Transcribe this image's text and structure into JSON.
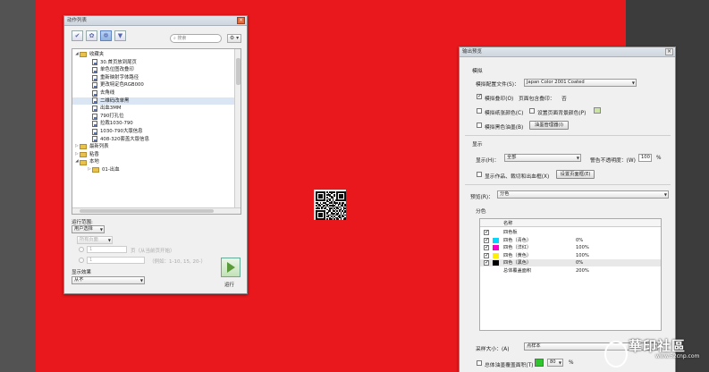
{
  "actions_panel": {
    "title": "动作列表",
    "close": "×",
    "search_placeholder": "搜索",
    "gear": "⚙ ▾",
    "tree": [
      {
        "label": "收藏夹",
        "type": "folder",
        "level": 0,
        "expanded": true
      },
      {
        "label": "30.首页放到尾页",
        "type": "doc",
        "level": 1
      },
      {
        "label": "单色位图改叠印",
        "type": "doc",
        "level": 1
      },
      {
        "label": "重新映射字体路径",
        "type": "doc",
        "level": 1
      },
      {
        "label": "更改特定色RGB000",
        "type": "doc",
        "level": 1
      },
      {
        "label": "去角线",
        "type": "doc",
        "level": 1
      },
      {
        "label": "二维码改单黑",
        "type": "doc",
        "level": 1,
        "selected": true
      },
      {
        "label": "出血3MM",
        "type": "doc",
        "level": 1
      },
      {
        "label": "790打孔位",
        "type": "doc",
        "level": 1
      },
      {
        "label": "拉裁1030-790",
        "type": "doc",
        "level": 1
      },
      {
        "label": "1030-790大版信息",
        "type": "doc",
        "level": 1
      },
      {
        "label": "408-320套盖大版信息",
        "type": "doc",
        "level": 1
      },
      {
        "label": "最新列表",
        "type": "folder",
        "level": 0
      },
      {
        "label": "粘香",
        "type": "folder",
        "level": 0
      },
      {
        "label": "本地",
        "type": "folder",
        "level": 0,
        "expanded": true
      },
      {
        "label": "01-出血",
        "type": "folder",
        "level": 1
      }
    ],
    "run_range_label": "运行范围:",
    "run_range_value": "用户选择",
    "pages_value": "所有页面",
    "from_value": "1",
    "page_suffix": "页（从当前页开始）",
    "example_value": "1",
    "example_hint": "（例如：1-10, 15, 20-）",
    "show_effect_label": "显示效果",
    "show_effect_value": "从不",
    "run_label": "运行"
  },
  "preview_panel": {
    "title": "输出预览",
    "simulate_label": "模拟",
    "profile_label": "模拟配置文件(S)：",
    "profile_value": "Japan Color 2001 Coated",
    "overprint_label": "模拟叠印(O)",
    "ink_label": "页面包含叠印：",
    "ink_value": "否",
    "paper_color_label": "模拟纸张颜色(C)",
    "page_bg_label": "设置页面背景颜色(P)",
    "black_ink_label": "模拟黑色油墨(B)",
    "ink_manager_label": "油墨管理器(I)",
    "show_section": "显示",
    "show_label": "显示(H)：",
    "show_value": "全部",
    "warn_label": "警告不透明度：(W)",
    "warn_value": "100",
    "percent": "%",
    "trim_label": "显示作品、裁切和出血框(X)",
    "page_box_label": "设置页面框(E)",
    "preview_label": "预览(R)：",
    "preview_value": "分色",
    "sep_label": "分色",
    "col_name": "名称",
    "rows": [
      {
        "name": "四色板",
        "value": "",
        "color": ""
      },
      {
        "name": "四色（青色）",
        "value": "0%",
        "color": "#00d8ff"
      },
      {
        "name": "四色（洋红）",
        "value": "100%",
        "color": "#ff00cc"
      },
      {
        "name": "四色（黄色）",
        "value": "100%",
        "color": "#ffef00"
      },
      {
        "name": "四色（黑色）",
        "value": "0%",
        "color": "#000000"
      },
      {
        "name": "总体覆盖面积",
        "value": "200%",
        "color": ""
      }
    ],
    "sample_label": "采样大小：(A)",
    "sample_value": "点样本",
    "total_label": "总体油墨覆盖面积(T)",
    "total_value": "80"
  },
  "watermark": {
    "brand": "華印社區",
    "url": "www.52cnp.com"
  },
  "colors": {
    "page_red": "#e8181c",
    "workspace": "#535353"
  }
}
